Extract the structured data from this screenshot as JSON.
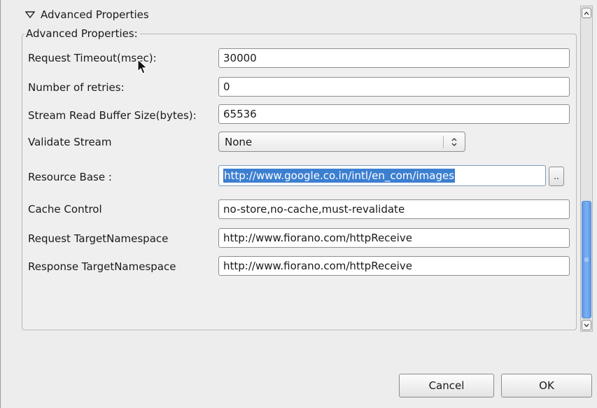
{
  "section": {
    "header_label": "Advanced Properties",
    "header_icon": "triangle-down-icon",
    "group_title": "Advanced Properties:"
  },
  "fields": {
    "request_timeout": {
      "label": "Request Timeout(msec):",
      "value": "30000"
    },
    "retries": {
      "label": "Number of retries:",
      "value": "0"
    },
    "buffer_size": {
      "label": "Stream Read Buffer Size(bytes):",
      "value": "65536"
    },
    "validate_stream": {
      "label": "Validate Stream",
      "value": "None"
    },
    "resource_base": {
      "label": "Resource Base :",
      "value": "http://www.google.co.in/intl/en_com/images",
      "browse_label": ".."
    },
    "cache_control": {
      "label": "Cache Control",
      "value": "no-store,no-cache,must-revalidate"
    },
    "request_ns": {
      "label": "Request TargetNamespace",
      "value": "http://www.fiorano.com/httpReceive"
    },
    "response_ns": {
      "label": "Response TargetNamespace",
      "value": "http://www.fiorano.com/httpReceive"
    }
  },
  "buttons": {
    "cancel": "Cancel",
    "ok": "OK"
  },
  "colors": {
    "selection": "#3c7fd1",
    "scroll_thumb": "#5b97e6"
  }
}
